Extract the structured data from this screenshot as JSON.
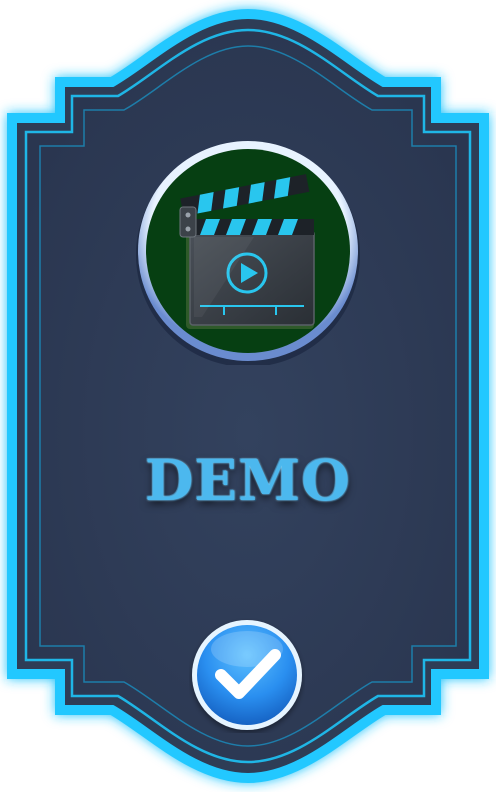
{
  "card": {
    "title": "DEMO"
  },
  "icons": {
    "badge": "clapperboard-play-icon",
    "confirm": "checkmark-icon"
  },
  "colors": {
    "frame_glow": "#22c8ff",
    "frame_fill": "#2e3c56",
    "badge_fill": "#063f12",
    "badge_ring": "#cfe6ff",
    "title_color": "#4cb8ee",
    "check_blue": "#2a8ff0"
  }
}
